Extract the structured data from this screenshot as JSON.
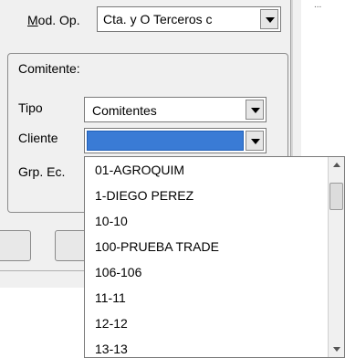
{
  "header": {
    "right_text": "...",
    "mod_op": {
      "label": "Mod. Op.",
      "access_key": "M",
      "label_rest": "od. Op.",
      "value": "Cta. y O Terceros c"
    }
  },
  "comitente": {
    "group_title": "Comitente:",
    "tipo": {
      "label": "Tipo",
      "value": "Comitentes"
    },
    "cliente": {
      "label": "Cliente",
      "value": ""
    },
    "grp_ec": {
      "label": "Grp. Ec."
    }
  },
  "dropdown": {
    "items": [
      "01-AGROQUIM",
      "1-DIEGO PEREZ",
      "10-10",
      "100-PRUEBA TRADE",
      "106-106",
      "11-11",
      "12-12",
      "13-13"
    ]
  }
}
